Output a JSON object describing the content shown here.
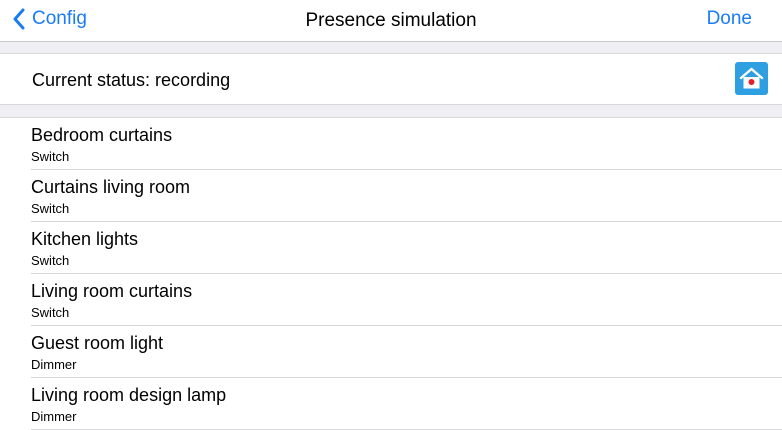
{
  "navbar": {
    "back_label": "Config",
    "title": "Presence simulation",
    "done_label": "Done"
  },
  "status": {
    "text": "Current status: recording",
    "icon": "home-record-icon"
  },
  "devices": [
    {
      "name": "Bedroom curtains",
      "type": "Switch"
    },
    {
      "name": "Curtains living room",
      "type": "Switch"
    },
    {
      "name": "Kitchen lights",
      "type": "Switch"
    },
    {
      "name": "Living room curtains",
      "type": "Switch"
    },
    {
      "name": "Guest room light",
      "type": "Dimmer"
    },
    {
      "name": "Living room design lamp",
      "type": "Dimmer"
    }
  ],
  "colors": {
    "accent": "#1a7cf5",
    "home_button": "#2e9fe0",
    "record_dot": "#e0202a",
    "separator_bg": "#efeff4"
  }
}
